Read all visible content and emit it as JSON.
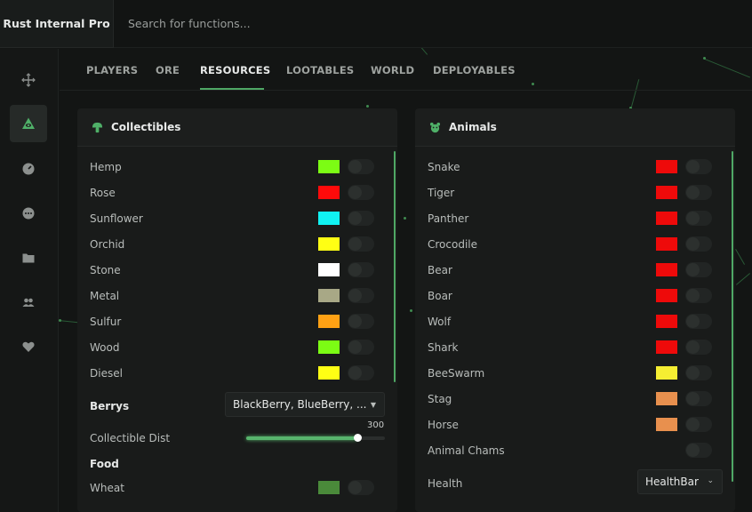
{
  "app": {
    "title": "Rust Internal Pro",
    "search_placeholder": "Search for functions..."
  },
  "sidebar": {
    "items": [
      {
        "icon": "crosshair-move-icon",
        "active": false
      },
      {
        "icon": "eye-triangle-icon",
        "active": true
      },
      {
        "icon": "gauge-icon",
        "active": false
      },
      {
        "icon": "chat-bubble-icon",
        "active": false
      },
      {
        "icon": "folder-icon",
        "active": false
      },
      {
        "icon": "users-icon",
        "active": false
      },
      {
        "icon": "heart-icon",
        "active": false
      }
    ]
  },
  "tabs": [
    {
      "label": "PLAYERS",
      "active": false
    },
    {
      "label": "ORE",
      "active": false
    },
    {
      "label": "RESOURCES",
      "active": true
    },
    {
      "label": "LOOTABLES",
      "active": false
    },
    {
      "label": "WORLD",
      "active": false
    },
    {
      "label": "DEPLOYABLES",
      "active": false
    }
  ],
  "collectibles": {
    "title": "Collectibles",
    "icon": "mushroom-icon",
    "items": [
      {
        "label": "Hemp",
        "color": "#7cfc14"
      },
      {
        "label": "Rose",
        "color": "#ff0a0a"
      },
      {
        "label": "Sunflower",
        "color": "#10f2f2"
      },
      {
        "label": "Orchid",
        "color": "#ffff14"
      },
      {
        "label": "Stone",
        "color": "#ffffff"
      },
      {
        "label": "Metal",
        "color": "#a8a886"
      },
      {
        "label": "Sulfur",
        "color": "#ffa114"
      },
      {
        "label": "Wood",
        "color": "#7cfc14"
      },
      {
        "label": "Diesel",
        "color": "#ffff14"
      }
    ],
    "berrys": {
      "label": "Berrys",
      "value": "BlackBerry, BlueBerry, ..."
    },
    "dist": {
      "label": "Collectible Dist",
      "value": "300",
      "fraction": 0.8
    },
    "food_label": "Food",
    "food_items": [
      {
        "label": "Wheat",
        "color": "#4a8a3a"
      }
    ]
  },
  "animals": {
    "title": "Animals",
    "icon": "bear-icon",
    "items": [
      {
        "label": "Snake",
        "color": "#ee0a0a"
      },
      {
        "label": "Tiger",
        "color": "#ee0a0a"
      },
      {
        "label": "Panther",
        "color": "#ee0a0a"
      },
      {
        "label": "Crocodile",
        "color": "#ee0a0a"
      },
      {
        "label": "Bear",
        "color": "#ee0a0a"
      },
      {
        "label": "Boar",
        "color": "#ee0a0a"
      },
      {
        "label": "Wolf",
        "color": "#ee0a0a"
      },
      {
        "label": "Shark",
        "color": "#ee0a0a"
      },
      {
        "label": "BeeSwarm",
        "color": "#f5ee32"
      },
      {
        "label": "Stag",
        "color": "#e8904e"
      },
      {
        "label": "Horse",
        "color": "#e8904e"
      }
    ],
    "chams_label": "Animal Chams",
    "health": {
      "label": "Health",
      "value": "HealthBar"
    }
  }
}
